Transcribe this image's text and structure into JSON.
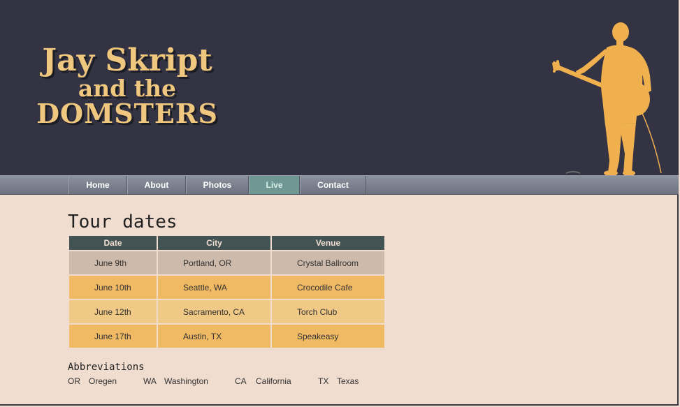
{
  "logo": {
    "line1": "Jay Skript",
    "line2": "and the",
    "line3": "DOMSTERS"
  },
  "nav": {
    "items": [
      {
        "label": "Home"
      },
      {
        "label": "About"
      },
      {
        "label": "Photos"
      },
      {
        "label": "Live"
      },
      {
        "label": "Contact"
      }
    ],
    "active": "Live"
  },
  "main": {
    "title": "Tour dates",
    "table": {
      "headers": [
        "Date",
        "City",
        "Venue"
      ],
      "rows": [
        [
          "June 9th",
          "Portland, OR",
          "Crystal Ballroom"
        ],
        [
          "June 10th",
          "Seattle, WA",
          "Crocodile Cafe"
        ],
        [
          "June 12th",
          "Sacramento, CA",
          "Torch Club"
        ],
        [
          "June 17th",
          "Austin, TX",
          "Speakeasy"
        ]
      ]
    },
    "abbreviations": {
      "title": "Abbreviations",
      "items": [
        {
          "code": "OR",
          "name": "Oregen"
        },
        {
          "code": "WA",
          "name": "Washington"
        },
        {
          "code": "CA",
          "name": "California"
        },
        {
          "code": "TX",
          "name": "Texas"
        }
      ]
    }
  },
  "colors": {
    "header_bg": "#333344",
    "logo": "#f0c77e",
    "page_bg": "#f0ddd0",
    "table_header": "#435354",
    "row_alt_1": "#cdbaab",
    "row_alt_2": "#f0b964",
    "row_alt_3": "#f0c987",
    "nav_active": "#6f9793"
  }
}
